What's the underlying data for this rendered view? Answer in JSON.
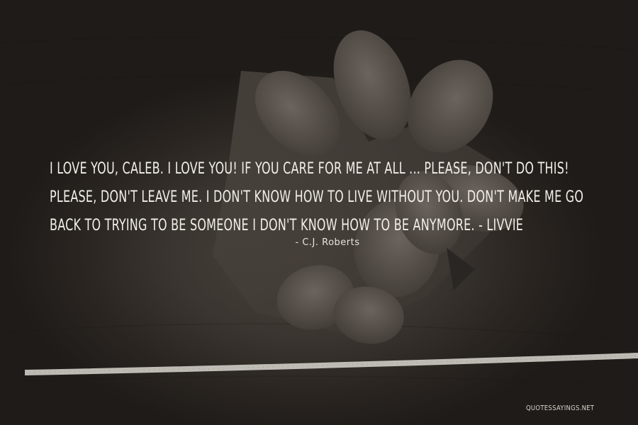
{
  "quote": {
    "text": "I love you, Caleb. I love you! If you care for me at all ... please, don't do this! Please, don't leave me. I don't know how to live without you. Don't make me go back to trying to be someone I don't know how to be anymore. - Livvie",
    "author": "- C.J. Roberts"
  },
  "watermark": "QUOTESSAYINGS.NET"
}
